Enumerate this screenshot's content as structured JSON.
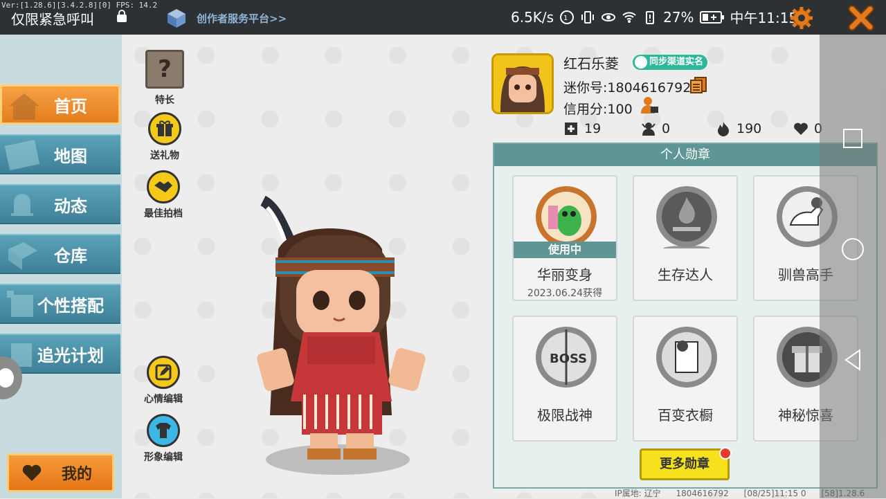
{
  "status_bar": {
    "version_text": "Ver:[1.28.6][3.4.2.8][0] FPS: 14.2",
    "emergency_text": "仅限紧急呼叫",
    "creator_link": "创作者服务平台>>",
    "network_speed": "6.5K/s",
    "battery": "27%",
    "time": "中午11:15"
  },
  "sidebar": {
    "items": [
      {
        "label": "首页",
        "icon": "house-icon",
        "active": true
      },
      {
        "label": "地图",
        "icon": "map-icon",
        "active": false
      },
      {
        "label": "动态",
        "icon": "bell-icon",
        "active": false
      },
      {
        "label": "仓库",
        "icon": "box-icon",
        "active": false
      },
      {
        "label": "个性搭配",
        "icon": "shirt-icon",
        "active": false
      },
      {
        "label": "追光计划",
        "icon": "robot-icon",
        "active": false
      }
    ],
    "mine_label": "我的"
  },
  "side_actions": {
    "specialty": "特长",
    "gift": "送礼物",
    "best_partner": "最佳拍档",
    "mood_edit": "心情编辑",
    "image_edit": "形象编辑"
  },
  "profile": {
    "username": "红石乐菱",
    "realname_badge": "同步渠道实名",
    "mini_id": "迷你号:1804616792",
    "credit": "信用分:100",
    "stats": {
      "follow": "19",
      "fans": "0",
      "popularity": "190",
      "likes": "0"
    }
  },
  "badges": {
    "title": "个人勋章",
    "in_use_label": "使用中",
    "items": [
      {
        "name": "华丽变身",
        "date": "2023.06.24获得",
        "in_use": true,
        "icon": "dinosaur-medal-icon"
      },
      {
        "name": "生存达人",
        "date": "",
        "in_use": false,
        "icon": "campfire-medal-icon"
      },
      {
        "name": "驯兽高手",
        "date": "",
        "in_use": false,
        "icon": "horse-medal-icon"
      },
      {
        "name": "极限战神",
        "date": "",
        "in_use": false,
        "icon": "boss-medal-icon"
      },
      {
        "name": "百变衣橱",
        "date": "",
        "in_use": false,
        "icon": "wardrobe-medal-icon"
      },
      {
        "name": "神秘惊喜",
        "date": "",
        "in_use": false,
        "icon": "giftbox-medal-icon"
      }
    ],
    "more_button": "更多勋章"
  },
  "footer": {
    "ip_location": "IP属地: 辽宁",
    "uid": "1804616792",
    "timestamp": "[08/25]11:15 0",
    "build": "[58]1.28.6"
  }
}
